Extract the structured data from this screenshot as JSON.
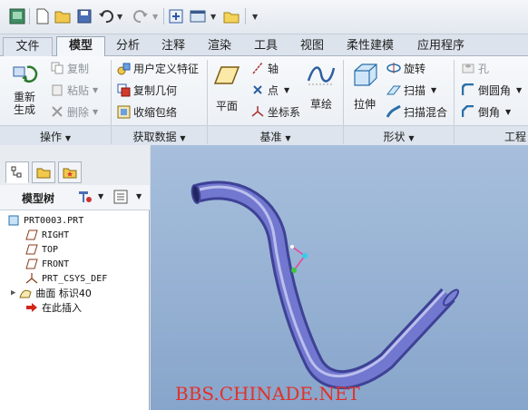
{
  "quick_access": {
    "icons": [
      "app-icon",
      "new-icon",
      "open-icon",
      "save-icon",
      "undo-icon",
      "redo-icon",
      "regenerate-icon",
      "windows-icon",
      "folder-icon",
      "customize-icon"
    ]
  },
  "tabs": [
    {
      "label": "文件",
      "active": false
    },
    {
      "label": "模型",
      "active": true
    },
    {
      "label": "分析",
      "active": false
    },
    {
      "label": "注释",
      "active": false
    },
    {
      "label": "渲染",
      "active": false
    },
    {
      "label": "工具",
      "active": false
    },
    {
      "label": "视图",
      "active": false
    },
    {
      "label": "柔性建模",
      "active": false
    },
    {
      "label": "应用程序",
      "active": false
    }
  ],
  "ribbon": {
    "operations": {
      "regenerate": "重新生成",
      "copy": "复制",
      "paste": "粘贴",
      "delete": "删除",
      "group": "操作"
    },
    "get_data": {
      "udf": "用户定义特征",
      "copy_geometry": "复制几何",
      "shrinkwrap": "收缩包络",
      "group": "获取数据"
    },
    "datum": {
      "plane": "平面",
      "axis": "轴",
      "point": "点",
      "csys": "坐标系",
      "sketch": "草绘",
      "group": "基准"
    },
    "shapes": {
      "extrude": "拉伸",
      "revolve": "旋转",
      "sweep": "扫描",
      "swept_blend": "扫描混合",
      "group": "形状"
    },
    "engineering": {
      "hole": "孔",
      "round": "倒圆角",
      "chamfer": "倒角",
      "group": "工程"
    }
  },
  "model_tree": {
    "header": "模型树",
    "items": [
      {
        "label": "PRT0003.PRT"
      },
      {
        "label": "RIGHT"
      },
      {
        "label": "TOP"
      },
      {
        "label": "FRONT"
      },
      {
        "label": "PRT_CSYS_DEF"
      },
      {
        "label": "曲面 标识40"
      },
      {
        "label": "在此插入"
      }
    ]
  },
  "watermark": "BBS.CHINADE.NET",
  "colors": {
    "viewport_top": "#a7bfdc",
    "viewport_bottom": "#87a5cb",
    "pipe": "#6f74c8",
    "watermark": "#e0322a"
  }
}
